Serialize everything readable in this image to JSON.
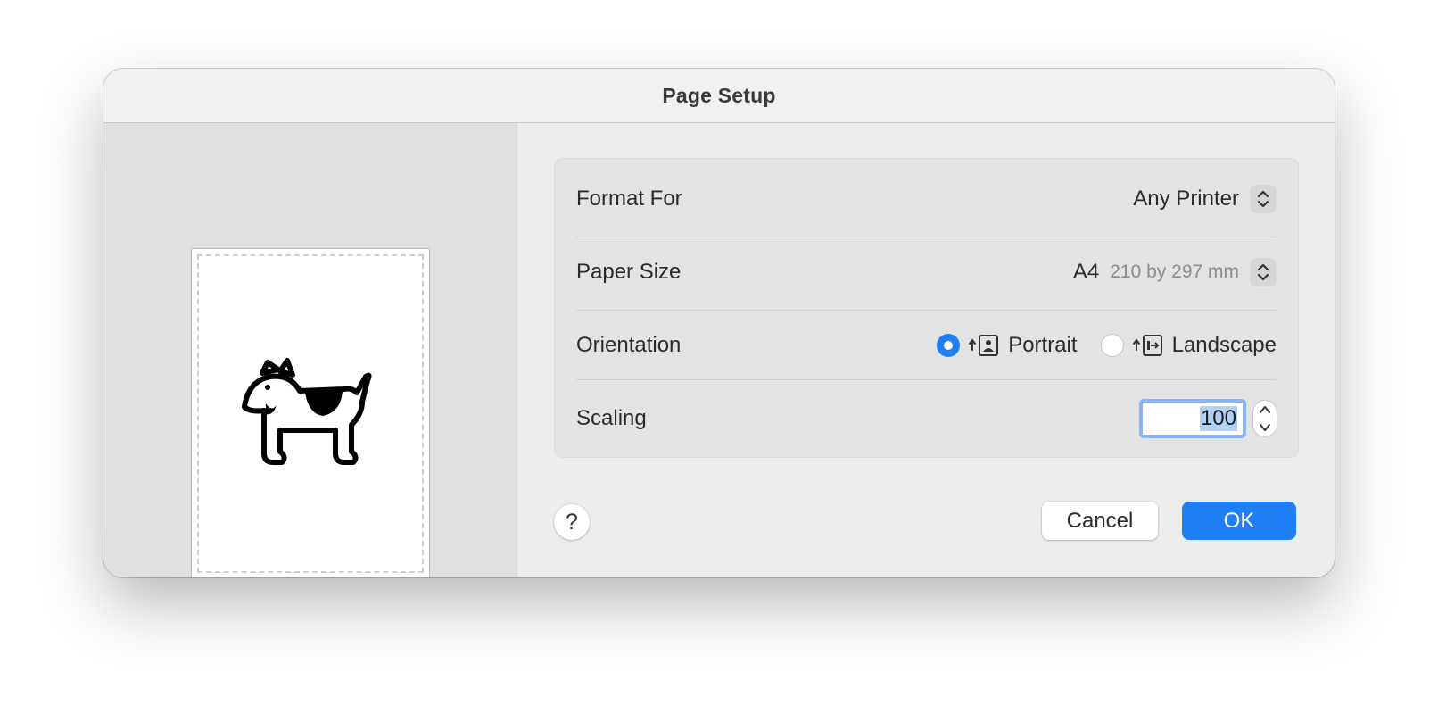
{
  "dialog": {
    "title": "Page Setup"
  },
  "preview": {
    "image_icon": "dog-icon"
  },
  "format_for": {
    "label": "Format For",
    "value": "Any Printer",
    "icon": "chevron-updown-icon"
  },
  "paper_size": {
    "label": "Paper Size",
    "value": "A4",
    "detail": "210 by 297 mm",
    "icon": "chevron-updown-icon"
  },
  "orientation": {
    "label": "Orientation",
    "options": [
      {
        "label": "Portrait",
        "selected": true,
        "icon": "portrait-icon"
      },
      {
        "label": "Landscape",
        "selected": false,
        "icon": "landscape-icon"
      }
    ]
  },
  "scaling": {
    "label": "Scaling",
    "value": "100"
  },
  "buttons": {
    "help": "?",
    "cancel": "Cancel",
    "ok": "OK"
  },
  "colors": {
    "accent": "#1f7ff5",
    "selection": "#b3d1f7",
    "focus_ring": "#8ab4f4"
  }
}
